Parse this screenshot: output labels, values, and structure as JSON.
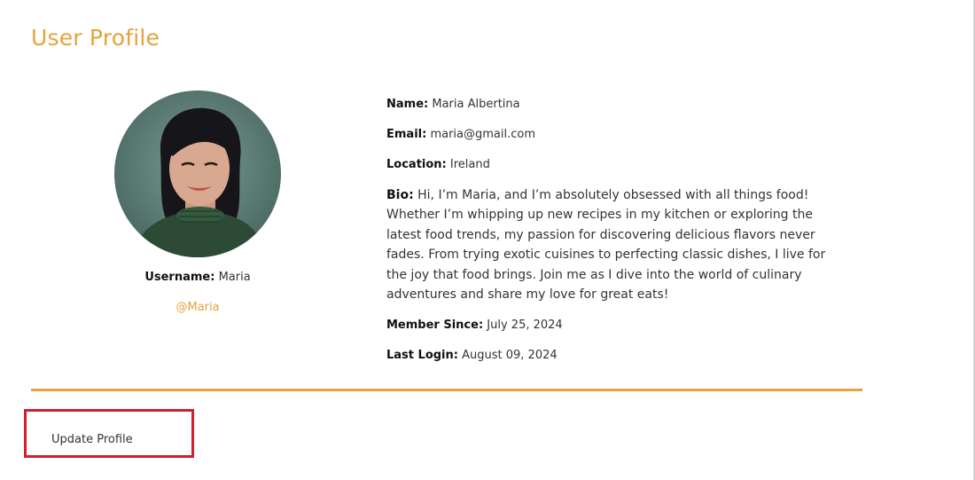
{
  "page": {
    "title": "User Profile"
  },
  "profile": {
    "avatar_alt": "Profile photo",
    "username_label": "Username:",
    "username_value": "Maria",
    "handle": "@Maria",
    "details": [
      {
        "label": "Name:",
        "value": "Maria Albertina"
      },
      {
        "label": "Email:",
        "value": "maria@gmail.com"
      },
      {
        "label": "Location:",
        "value": "Ireland"
      },
      {
        "label": "Bio:",
        "value": "Hi, I’m Maria, and I’m absolutely obsessed with all things food! Whether I’m whipping up new recipes in my kitchen or exploring the latest food trends, my passion for discovering delicious flavors never fades. From trying exotic cuisines to perfecting classic dishes, I live for the joy that food brings. Join me as I dive into the world of culinary adventures and share my love for great eats!"
      },
      {
        "label": "Member Since:",
        "value": "July 25, 2024"
      },
      {
        "label": "Last Login:",
        "value": "August 09, 2024"
      }
    ]
  },
  "actions": {
    "update_label": "Update Profile"
  },
  "colors": {
    "accent": "#e8a23b",
    "highlight_border": "#d0202e"
  }
}
